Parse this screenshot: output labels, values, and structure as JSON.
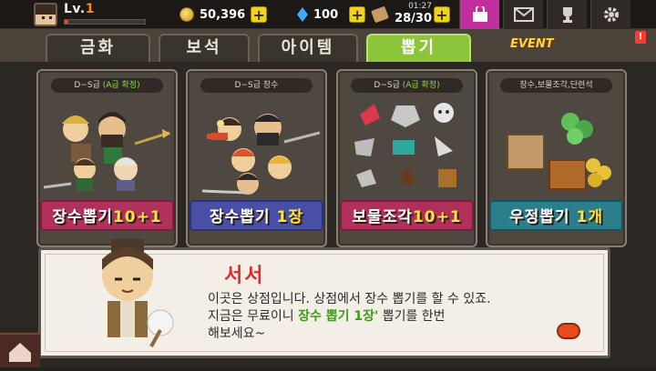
{
  "topbar": {
    "level_prefix": "Lv.",
    "level_num": "1",
    "gold": "50,396",
    "gems": "100",
    "stamina_time": "01:27",
    "stamina_count": "28/30",
    "xp_progress": 0.04
  },
  "tabs": [
    {
      "label": "금화"
    },
    {
      "label": "보석"
    },
    {
      "label": "아이템"
    },
    {
      "label": "뽑기",
      "active": true
    }
  ],
  "event_label": "EVENT",
  "event_badge": "!",
  "cards": [
    {
      "subtitle_a": "D~S급 ",
      "subtitle_hl": "(A급 확정)",
      "banner_main": "장수뽑기",
      "banner_accent": "10+1"
    },
    {
      "subtitle_a": "D~S급 장수",
      "subtitle_hl": "",
      "banner_main": "장수뽑기 ",
      "banner_accent": "1장"
    },
    {
      "subtitle_a": "D~S급 ",
      "subtitle_hl": "(A급 확정)",
      "banner_main": "보물조각",
      "banner_accent": "10+1"
    },
    {
      "subtitle_a": "장수,보물조각,단련석",
      "subtitle_hl": "",
      "banner_main": "우정뽑기 ",
      "banner_accent": "1개"
    }
  ],
  "dialog": {
    "speaker": "서서",
    "line1": "이곳은 상점입니다. 상점에서 장수 뽑기를 할 수 있죠.",
    "line2_a": "지금은 무료이니 ",
    "line2_hl": "장수 뽑기 1장'",
    "line2_b": " 뽑기를 한번",
    "line3": "해보세요~"
  },
  "colors": {
    "active_tab": "#8cc43a",
    "speaker": "#e02a2a",
    "highlight": "#3f9a1c",
    "shop": "#c02ea0"
  }
}
